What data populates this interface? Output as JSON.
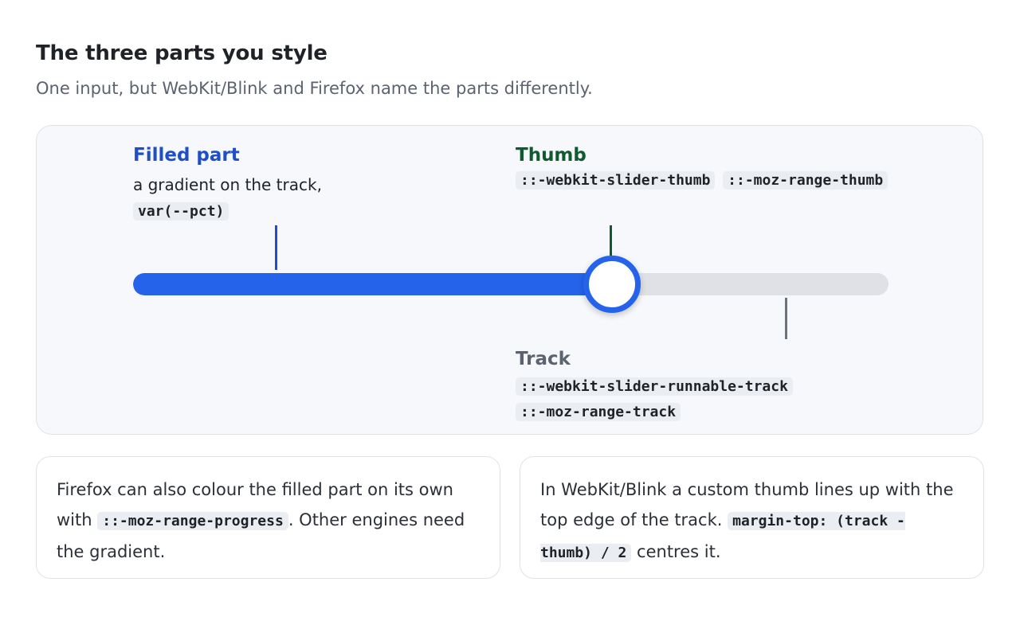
{
  "header": {
    "title": "The three parts you style",
    "subtitle": "One input, but WebKit/Blink and Firefox name the parts differently."
  },
  "slider": {
    "value_fraction": 0.634
  },
  "callouts": {
    "filled": {
      "label": "Filled part",
      "desc": "a gradient on the track,",
      "code": "var(--pct)"
    },
    "thumb": {
      "label": "Thumb",
      "codes": [
        "::-webkit-slider-thumb",
        "::-moz-range-thumb"
      ]
    },
    "track": {
      "label": "Track",
      "codes": [
        "::-webkit-slider-runnable-track",
        "::-moz-range-track"
      ]
    }
  },
  "notes": {
    "firefox": {
      "text_before": "Firefox can also colour the filled part on its own with ",
      "code": "::-moz-range-progress",
      "text_after": ". Other engines need the gradient."
    },
    "webkit": {
      "text_before": "In WebKit/Blink a custom thumb lines up with the top edge of the track. ",
      "code": "margin-top: (track - thumb) / 2",
      "text_after": " centres it."
    }
  },
  "colors": {
    "filled": "#2563eb",
    "filled_label": "#1f4fc8",
    "thumb_label": "#0f5a2e",
    "track": "#dfe1e6",
    "track_label": "#5b6270"
  }
}
